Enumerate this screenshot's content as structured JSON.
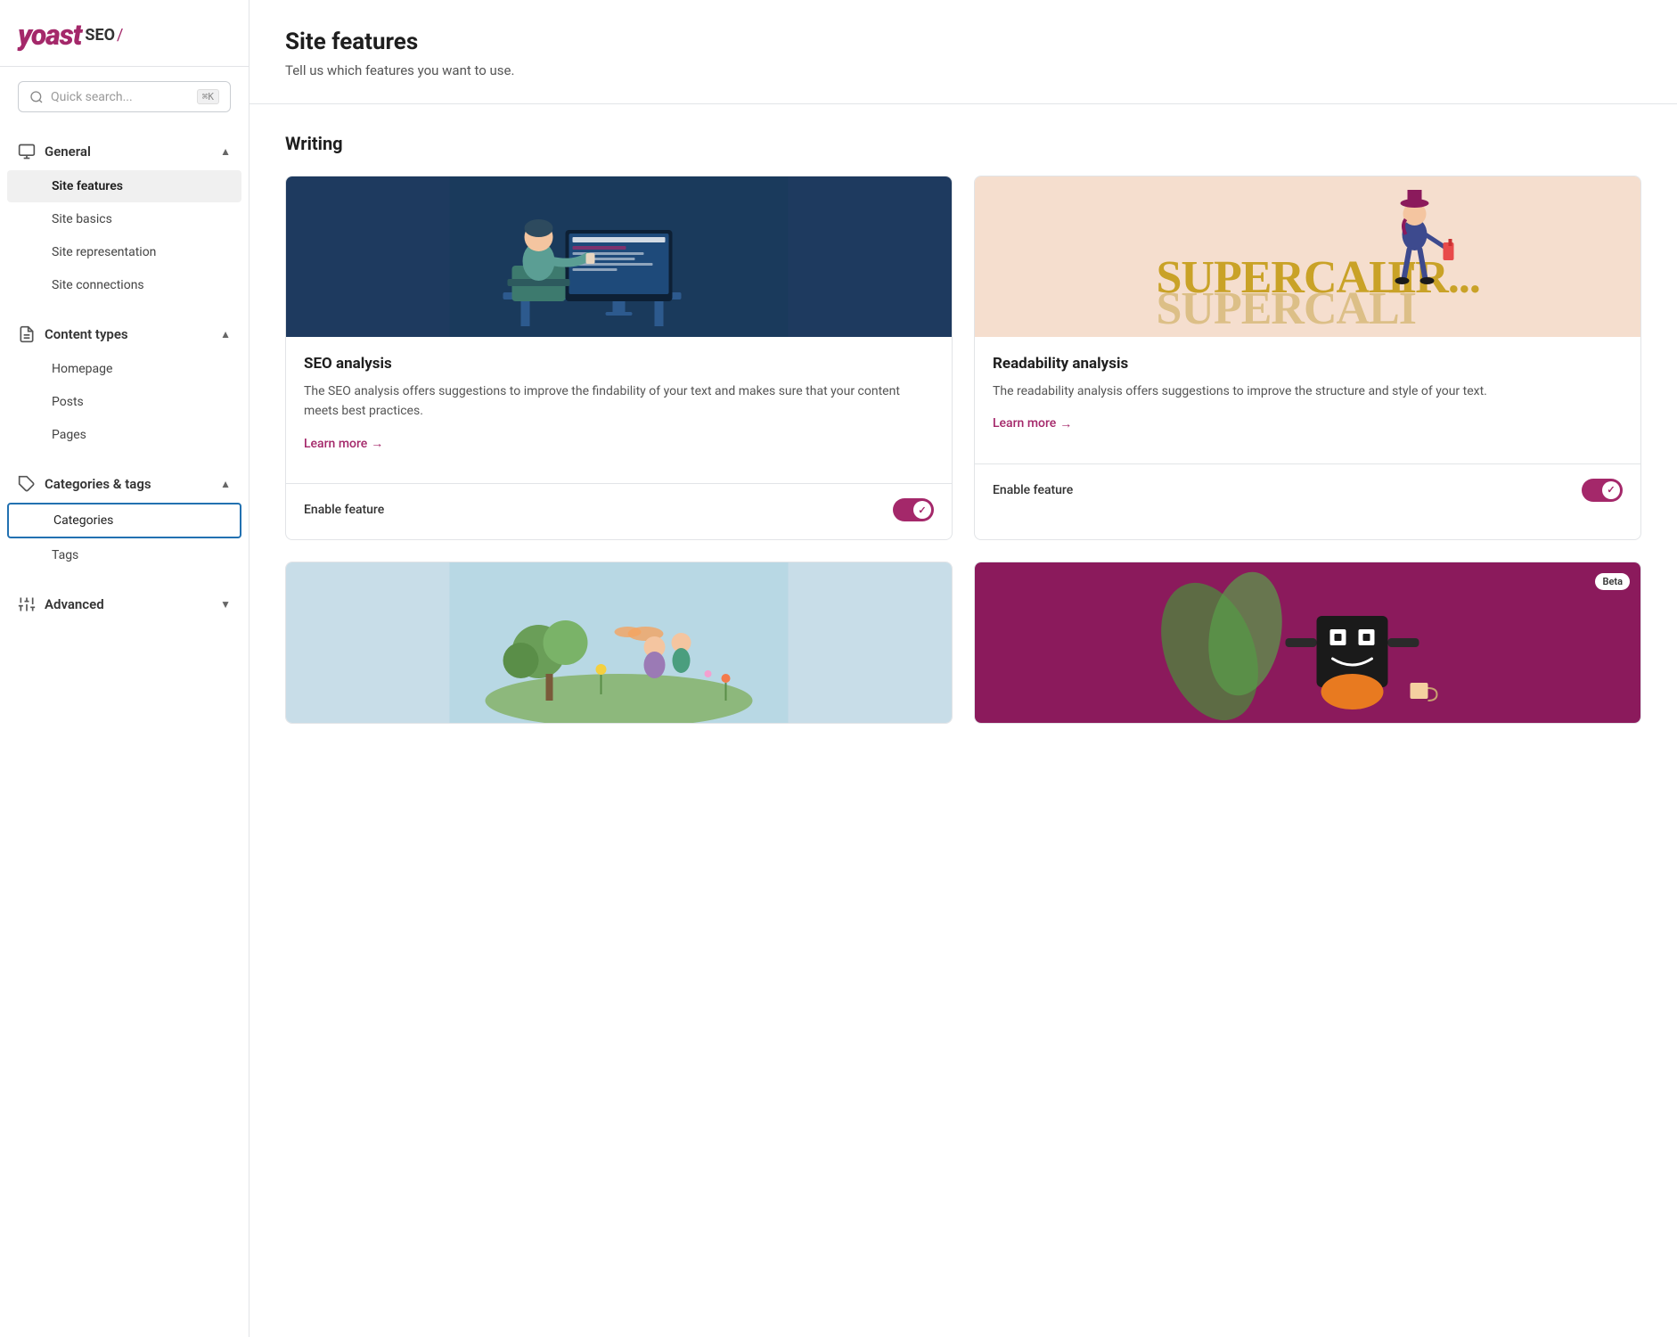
{
  "logo": {
    "yoast": "yoast",
    "seo": "SEO",
    "slash": "/"
  },
  "search": {
    "placeholder": "Quick search...",
    "shortcut": "⌘K"
  },
  "sidebar": {
    "sections": [
      {
        "id": "general",
        "title": "General",
        "expanded": true,
        "items": [
          {
            "id": "site-features",
            "label": "Site features",
            "active": true
          },
          {
            "id": "site-basics",
            "label": "Site basics",
            "active": false
          },
          {
            "id": "site-representation",
            "label": "Site representation",
            "active": false
          },
          {
            "id": "site-connections",
            "label": "Site connections",
            "active": false
          }
        ]
      },
      {
        "id": "content-types",
        "title": "Content types",
        "expanded": true,
        "items": [
          {
            "id": "homepage",
            "label": "Homepage",
            "active": false
          },
          {
            "id": "posts",
            "label": "Posts",
            "active": false
          },
          {
            "id": "pages",
            "label": "Pages",
            "active": false
          }
        ]
      },
      {
        "id": "categories-tags",
        "title": "Categories & tags",
        "expanded": true,
        "items": [
          {
            "id": "categories",
            "label": "Categories",
            "active": false,
            "selected": true
          },
          {
            "id": "tags",
            "label": "Tags",
            "active": false
          }
        ]
      },
      {
        "id": "advanced",
        "title": "Advanced",
        "expanded": false,
        "items": []
      }
    ]
  },
  "page": {
    "title": "Site features",
    "subtitle": "Tell us which features you want to use."
  },
  "writing_section": {
    "title": "Writing",
    "cards": [
      {
        "id": "seo-analysis",
        "title": "SEO analysis",
        "description": "The SEO analysis offers suggestions to improve the findability of your text and makes sure that your content meets best practices.",
        "learn_more": "Learn more",
        "learn_more_arrow": "→",
        "enable_label": "Enable feature",
        "enabled": true,
        "image_type": "seo",
        "beta": false
      },
      {
        "id": "readability-analysis",
        "title": "Readability analysis",
        "description": "The readability analysis offers suggestions to improve the structure and style of your text.",
        "learn_more": "Learn more",
        "learn_more_arrow": "→",
        "enable_label": "Enable feature",
        "enabled": true,
        "image_type": "readability",
        "beta": false
      }
    ]
  },
  "bottom_cards": [
    {
      "id": "card-bottom-left",
      "image_type": "garden",
      "beta": false
    },
    {
      "id": "card-bottom-right",
      "image_type": "robot",
      "beta": true,
      "beta_label": "Beta"
    }
  ]
}
